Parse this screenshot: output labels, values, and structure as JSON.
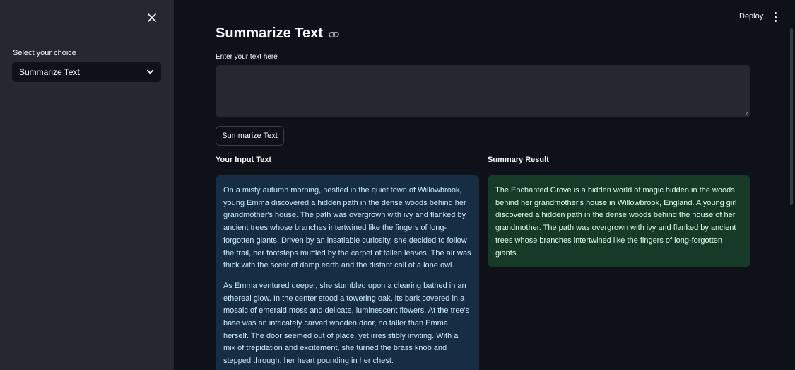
{
  "sidebar": {
    "select_label": "Select your choice",
    "selected_option": "Summarize Text"
  },
  "header": {
    "deploy_label": "Deploy"
  },
  "main": {
    "title": "Summarize Text",
    "input_label": "Enter your text here",
    "input_value": "",
    "button_label": "Summarize Text",
    "input_heading": "Your Input Text",
    "summary_heading": "Summary Result",
    "input_paragraphs": [
      "On a misty autumn morning, nestled in the quiet town of Willowbrook, young Emma discovered a hidden path in the dense woods behind her grandmother's house. The path was overgrown with ivy and flanked by ancient trees whose branches intertwined like the fingers of long-forgotten giants. Driven by an insatiable curiosity, she decided to follow the trail, her footsteps muffled by the carpet of fallen leaves. The air was thick with the scent of damp earth and the distant call of a lone owl.",
      "As Emma ventured deeper, she stumbled upon a clearing bathed in an ethereal glow. In the center stood a towering oak, its bark covered in a mosaic of emerald moss and delicate, luminescent flowers. At the tree's base was an intricately carved wooden door, no taller than Emma herself. The door seemed out of place, yet irresistibly inviting. With a mix of trepidation and excitement, she turned the brass knob and stepped through, her heart pounding in her chest."
    ],
    "summary_text": "The Enchanted Grove is a hidden world of magic hidden in the woods behind her grandmother's house in Willowbrook, England. A young girl discovered a hidden path in the dense woods behind the house of her grandmother. The path was overgrown with ivy and flanked by ancient trees whose branches intertwined like the fingers of long-forgotten giants."
  },
  "colors": {
    "background": "#0e1117",
    "sidebar": "#262730",
    "info_box": "#172d43",
    "success_box": "#173928"
  },
  "icons": [
    "close-icon",
    "chevron-down-icon",
    "link-icon",
    "more-vertical-icon"
  ]
}
